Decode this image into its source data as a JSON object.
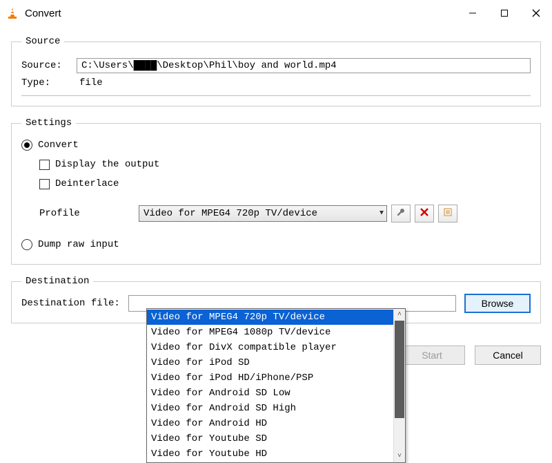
{
  "window": {
    "title": "Convert"
  },
  "source": {
    "legend": "Source",
    "source_label": "Source:",
    "source_value": "C:\\Users\\████\\Desktop\\Phil\\boy and world.mp4",
    "type_label": "Type:",
    "type_value": "file"
  },
  "settings": {
    "legend": "Settings",
    "convert_label": "Convert",
    "display_output_label": "Display the output",
    "deinterlace_label": "Deinterlace",
    "profile_label": "Profile",
    "profile_selected": "Video for MPEG4 720p TV/device",
    "profile_options": [
      "Video for MPEG4 720p TV/device",
      "Video for MPEG4 1080p TV/device",
      "Video for DivX compatible player",
      "Video for iPod SD",
      "Video for iPod HD/iPhone/PSP",
      "Video for Android SD Low",
      "Video for Android SD High",
      "Video for Android HD",
      "Video for Youtube SD",
      "Video for Youtube HD"
    ],
    "dump_raw_label": "Dump raw input"
  },
  "destination": {
    "legend": "Destination",
    "dest_label": "Destination file:",
    "browse_label": "Browse"
  },
  "footer": {
    "start_label": "Start",
    "cancel_label": "Cancel"
  }
}
